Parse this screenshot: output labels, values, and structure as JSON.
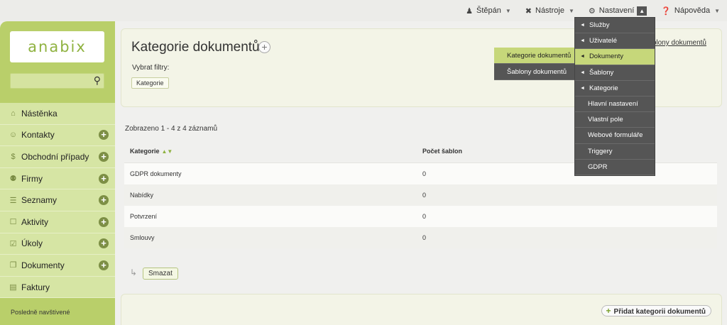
{
  "topnav": {
    "user": "Štěpán",
    "tools": "Nástroje",
    "settings": "Nastavení",
    "help": "Nápověda"
  },
  "sidebar": {
    "logo": "anabix",
    "search_placeholder": "",
    "items": [
      {
        "label": "Nástěnka",
        "icon": "home-icon",
        "plus": false
      },
      {
        "label": "Kontakty",
        "icon": "person-icon",
        "plus": true
      },
      {
        "label": "Obchodní případy",
        "icon": "dollar-icon",
        "plus": true
      },
      {
        "label": "Firmy",
        "icon": "people-icon",
        "plus": true
      },
      {
        "label": "Seznamy",
        "icon": "list-icon",
        "plus": true
      },
      {
        "label": "Aktivity",
        "icon": "clipboard-icon",
        "plus": true
      },
      {
        "label": "Úkoly",
        "icon": "task-icon",
        "plus": true
      },
      {
        "label": "Dokumenty",
        "icon": "documents-icon",
        "plus": true
      },
      {
        "label": "Faktury",
        "icon": "invoice-icon",
        "plus": false
      }
    ],
    "recent_title": "Posledně navštívené"
  },
  "page": {
    "title": "Kategorie dokumentů",
    "filter_label": "Vybrat filtry:",
    "filter_chip": "Kategorie",
    "right_link": "Šablony dokumentů",
    "count_text": "Zobrazeno 1 - 4 z 4 záznamů"
  },
  "table": {
    "headers": [
      "Kategorie",
      "Počet šablon"
    ],
    "rows": [
      [
        "GDPR dokumenty",
        "0"
      ],
      [
        "Nabídky",
        "0"
      ],
      [
        "Potvrzení",
        "0"
      ],
      [
        "Smlouvy",
        "0"
      ]
    ]
  },
  "actions": {
    "delete": "Smazat",
    "add_category": "Přidat kategorii dokumentů"
  },
  "settings_menu": [
    {
      "label": "Služby",
      "arrow": true,
      "selected": false
    },
    {
      "label": "Uživatelé",
      "arrow": true,
      "selected": false
    },
    {
      "label": "Dokumenty",
      "arrow": true,
      "selected": true
    },
    {
      "label": "Šablony",
      "arrow": true,
      "selected": false
    },
    {
      "label": "Kategorie",
      "arrow": true,
      "selected": false
    },
    {
      "label": "Hlavní nastavení",
      "arrow": false,
      "selected": false
    },
    {
      "label": "Vlastní pole",
      "arrow": false,
      "selected": false
    },
    {
      "label": "Webové formuláře",
      "arrow": false,
      "selected": false
    },
    {
      "label": "Triggery",
      "arrow": false,
      "selected": false
    },
    {
      "label": "GDPR",
      "arrow": false,
      "selected": false
    }
  ],
  "documents_submenu": [
    {
      "label": "Kategorie dokumentů",
      "selected": true
    },
    {
      "label": "Šablony dokumentů",
      "selected": false
    }
  ],
  "colors": {
    "accent": "#b9cf6a",
    "menu_bg": "#d6e5a4",
    "dropdown_bg": "#555555",
    "dropdown_selected": "#c6d77a"
  }
}
